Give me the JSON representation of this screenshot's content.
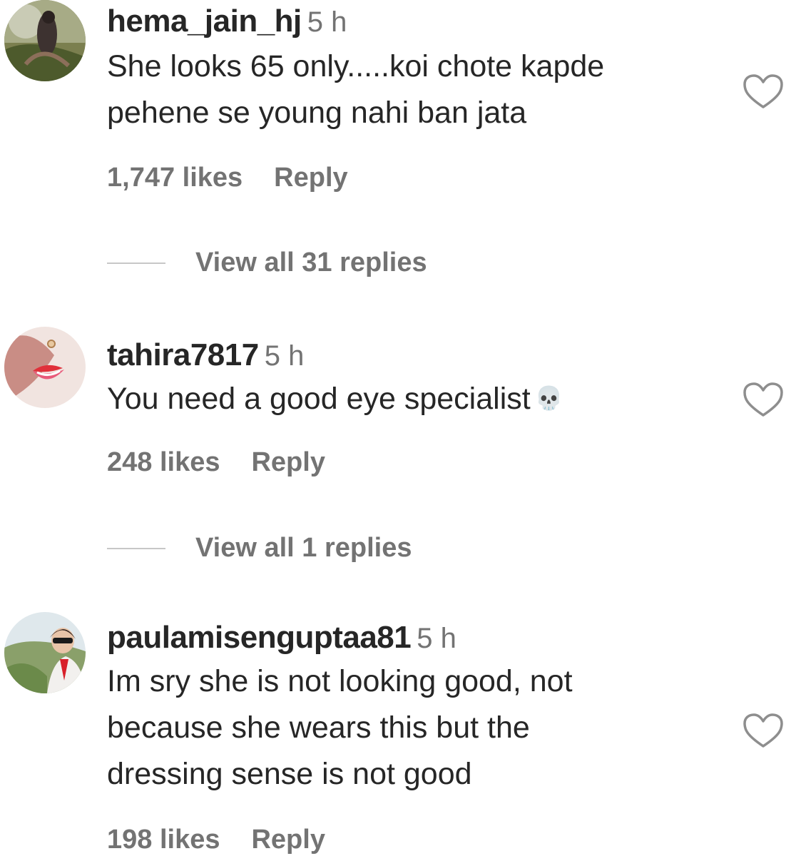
{
  "comments": [
    {
      "username": "hema_jain_hj",
      "time": "5 h",
      "text_lines": [
        "She looks 65 only.....koi chote kapde",
        "pehene se young nahi ban jata"
      ],
      "emoji": "",
      "likes": "1,747 likes",
      "reply": "Reply",
      "view_replies": "View all 31 replies"
    },
    {
      "username": "tahira7817",
      "time": "5 h",
      "text_lines": [
        "You need a good eye specialist"
      ],
      "emoji": "💀",
      "likes": "248 likes",
      "reply": "Reply",
      "view_replies": "View all 1 replies"
    },
    {
      "username": "paulamisenguptaa81",
      "time": "5 h",
      "text_lines": [
        "Im sry she is not looking good, not",
        "because she wears this but the",
        "dressing sense is not good"
      ],
      "emoji": "",
      "likes": "198 likes",
      "reply": "Reply"
    }
  ],
  "icons": {
    "like": "heart-outline-icon",
    "skull_emoji": "skull-emoji"
  },
  "colors": {
    "text": "#262626",
    "secondary": "#737373",
    "divider": "#c7c7c7"
  }
}
